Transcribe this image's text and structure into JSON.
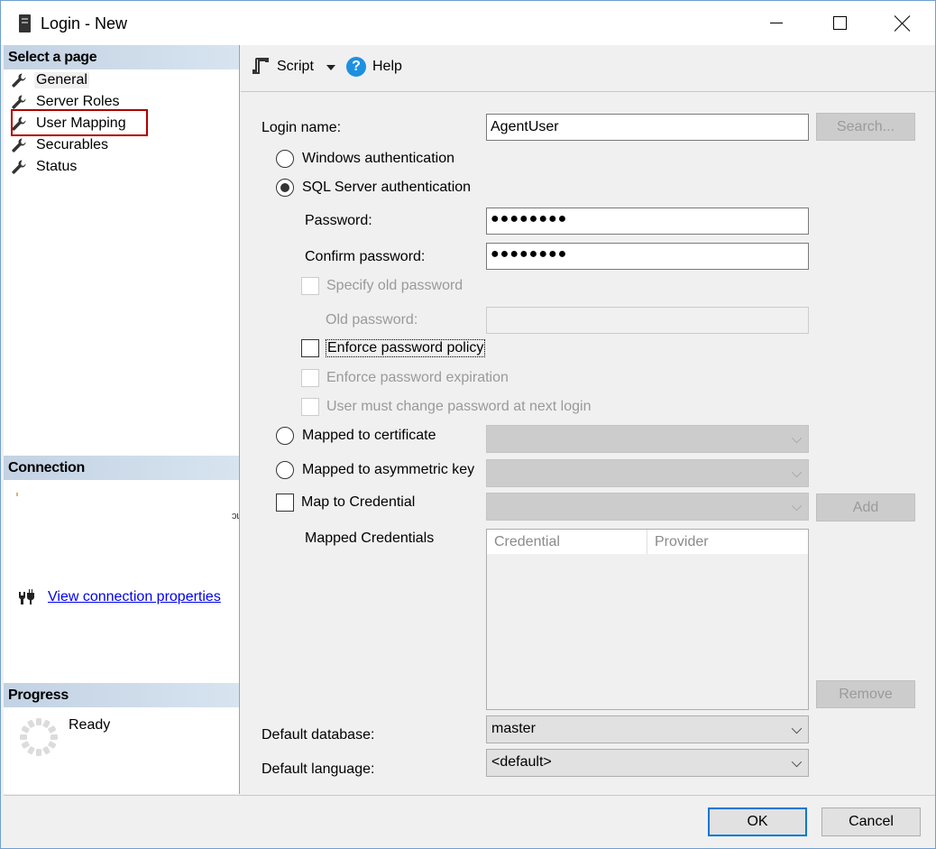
{
  "window": {
    "title": "Login - New",
    "icon": "server-icon",
    "controls": {
      "minimize": "minimize-icon",
      "maximize": "maximize-icon",
      "close": "close-icon"
    }
  },
  "left_pane": {
    "select_page_header": "Select a page",
    "pages": [
      {
        "label": "General",
        "icon": "wrench-icon",
        "selected": true
      },
      {
        "label": "Server Roles",
        "icon": "wrench-icon"
      },
      {
        "label": "User Mapping",
        "icon": "wrench-icon",
        "highlighted": true
      },
      {
        "label": "Securables",
        "icon": "wrench-icon"
      },
      {
        "label": "Status",
        "icon": "wrench-icon"
      }
    ],
    "connection_header": "Connection",
    "connection_stray_text": "ɔɩ",
    "view_connection_link": "View connection properties",
    "progress_header": "Progress",
    "progress_status": "Ready"
  },
  "toolbar": {
    "script_label": "Script",
    "help_label": "Help",
    "help_glyph": "?"
  },
  "form": {
    "login_name_label": "Login name:",
    "login_name_value": "AgentUser",
    "search_button": "Search...",
    "windows_auth_label": "Windows authentication",
    "sql_auth_label": "SQL Server authentication",
    "auth_selected": "sql",
    "password_label": "Password:",
    "password_value": "●●●●●●●●",
    "confirm_password_label": "Confirm password:",
    "confirm_password_value": "●●●●●●●●",
    "specify_old_password_label": "Specify old password",
    "old_password_label": "Old password:",
    "old_password_value": "",
    "enforce_policy_label": "Enforce password policy",
    "enforce_policy_checked": false,
    "enforce_expiration_label": "Enforce password expiration",
    "must_change_label": "User must change password at next login",
    "mapped_certificate_label": "Mapped to certificate",
    "mapped_asym_key_label": "Mapped to asymmetric key",
    "map_credential_label": "Map to Credential",
    "add_button": "Add",
    "mapped_credentials_label": "Mapped Credentials",
    "credentials_columns": [
      "Credential",
      "Provider"
    ],
    "credentials_rows": [],
    "remove_button": "Remove",
    "default_database_label": "Default database:",
    "default_database_value": "master",
    "default_language_label": "Default language:",
    "default_language_value": "<default>"
  },
  "footer": {
    "ok_button": "OK",
    "cancel_button": "Cancel"
  },
  "colors": {
    "highlight_box": "#b00000",
    "link": "#0000ee",
    "help_icon": "#1e90e0",
    "ok_focus": "#0078d7"
  }
}
